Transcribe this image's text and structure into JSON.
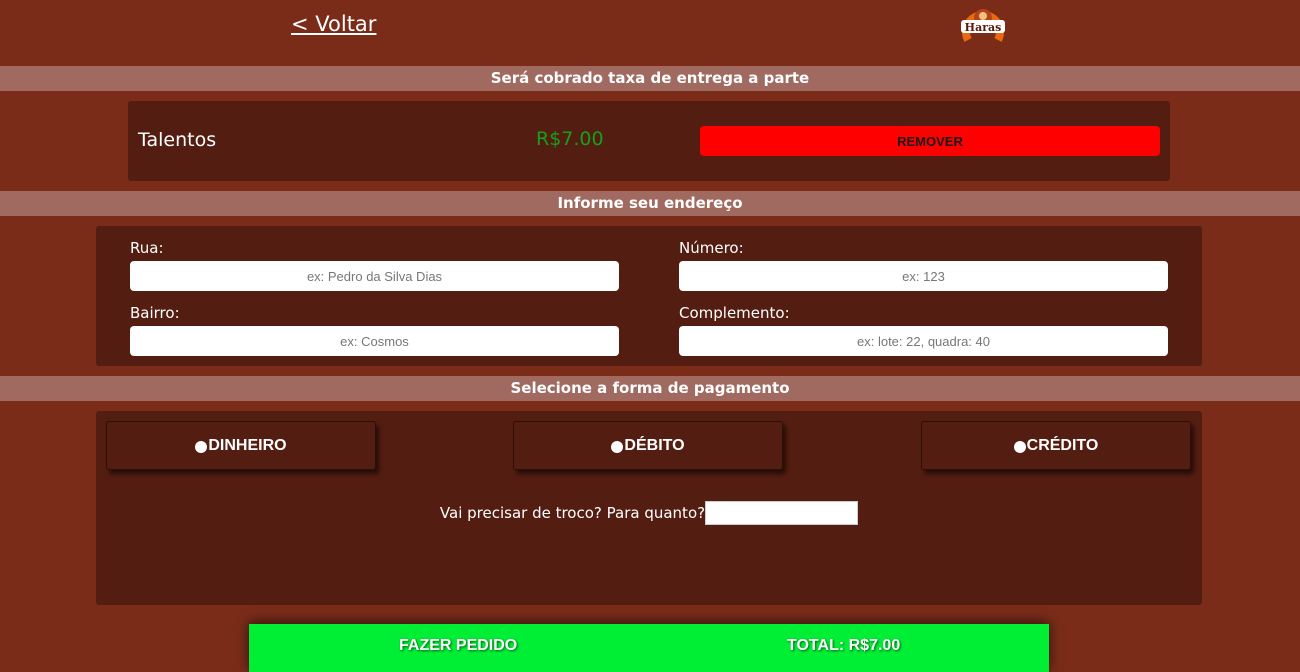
{
  "header": {
    "back_label": "< Voltar",
    "logo_text": "Haras"
  },
  "delivery_notice": "Será cobrado taxa de entrega a parte",
  "cart": {
    "items": [
      {
        "name": "Talentos",
        "price": "R$7.00",
        "remove_label": "REMOVER"
      }
    ]
  },
  "address": {
    "title": "Informe seu endereço",
    "street": {
      "label": "Rua:",
      "placeholder": "ex: Pedro da Silva Dias"
    },
    "number": {
      "label": "Número:",
      "placeholder": "ex: 123"
    },
    "neighborhood": {
      "label": "Bairro:",
      "placeholder": "ex: Cosmos"
    },
    "complement": {
      "label": "Complemento:",
      "placeholder": "ex: lote: 22, quadra: 40"
    }
  },
  "payment": {
    "title": "Selecione a forma de pagamento",
    "options": [
      "DINHEIRO",
      "DÉBITO",
      "CRÉDITO"
    ],
    "change_question": "Vai precisar de troco? Para quanto?"
  },
  "footer": {
    "order_label": "FAZER PEDIDO",
    "total_label": "TOTAL: R$7.00"
  },
  "colors": {
    "background": "#7a2c19",
    "panel": "#541d11",
    "section_bar": "#a06a60",
    "remove": "#ff0000",
    "price": "#15a01c",
    "order_bar": "#00ee34"
  }
}
